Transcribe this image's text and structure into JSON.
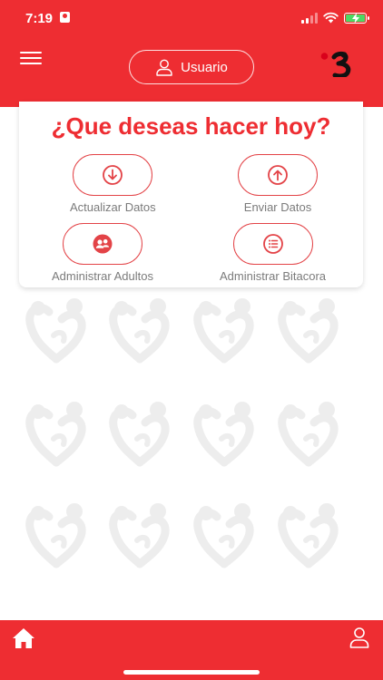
{
  "status_bar": {
    "time": "7:19"
  },
  "header": {
    "menu_icon": "hamburger-menu-icon",
    "user_button": {
      "label": "Usuario",
      "icon": "user-outline-icon"
    },
    "brand_logo": "brand-logo",
    "background_color": "#ee2d32"
  },
  "card": {
    "title": "¿Que deseas hacer hoy?",
    "actions": [
      {
        "label": "Actualizar Datos",
        "icon": "download-circle-icon"
      },
      {
        "label": "Enviar Datos",
        "icon": "upload-circle-icon"
      },
      {
        "label": "Administrar Adultos",
        "icon": "users-circle-icon"
      },
      {
        "label": "Administrar Bitacora",
        "icon": "list-circle-icon"
      }
    ]
  },
  "bottom_nav": {
    "items": [
      {
        "icon": "home-icon"
      },
      {
        "icon": "user-profile-icon"
      }
    ]
  },
  "colors": {
    "accent": "#ee2d32",
    "label_gray": "#7b7b7b"
  }
}
